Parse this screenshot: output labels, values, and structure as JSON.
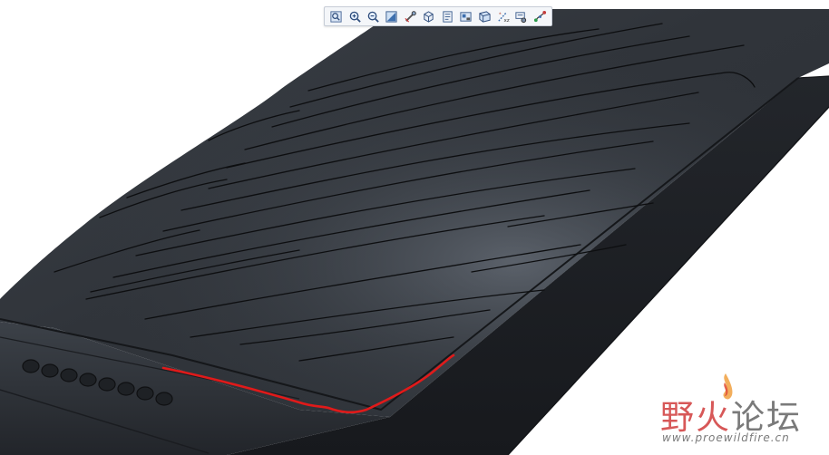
{
  "toolbar": {
    "buttons": [
      {
        "name": "refit-button",
        "icon": "refit-icon",
        "title": "Refit"
      },
      {
        "name": "zoom-in-button",
        "icon": "zoom-in-icon",
        "title": "Zoom In"
      },
      {
        "name": "zoom-out-button",
        "icon": "zoom-out-icon",
        "title": "Zoom Out"
      },
      {
        "name": "repaint-button",
        "icon": "repaint-icon",
        "title": "Repaint"
      },
      {
        "name": "spin-center-button",
        "icon": "spin-center-icon",
        "title": "Spin Center"
      },
      {
        "name": "display-style-button",
        "icon": "display-style-icon",
        "title": "Display Style"
      },
      {
        "name": "saved-orientations-button",
        "icon": "saved-orientations-icon",
        "title": "Saved Orientations"
      },
      {
        "name": "view-manager-button",
        "icon": "view-manager-icon",
        "title": "View Manager"
      },
      {
        "name": "perspective-view-button",
        "icon": "perspective-view-icon",
        "title": "Perspective View"
      },
      {
        "name": "datum-display-button",
        "icon": "datum-display-icon",
        "title": "Datum Display Filters"
      },
      {
        "name": "annotation-display-button",
        "icon": "annotation-display-icon",
        "title": "Annotation Display"
      },
      {
        "name": "spin-tool-button",
        "icon": "spin-tool-icon",
        "title": "Spin"
      }
    ]
  },
  "colors": {
    "body_dark": "#2f3339",
    "body_mid": "#454a52",
    "body_light": "#5a6069",
    "edge_line": "#111316",
    "highlight_curve": "#e01a1a",
    "watermark_red": "#d44a4a",
    "watermark_gray": "#6f6f6f"
  },
  "model": {
    "vent_slot_count": 8
  },
  "watermark": {
    "title_a": "野火",
    "title_b": "论坛",
    "url": "www.proewildfire.cn"
  }
}
